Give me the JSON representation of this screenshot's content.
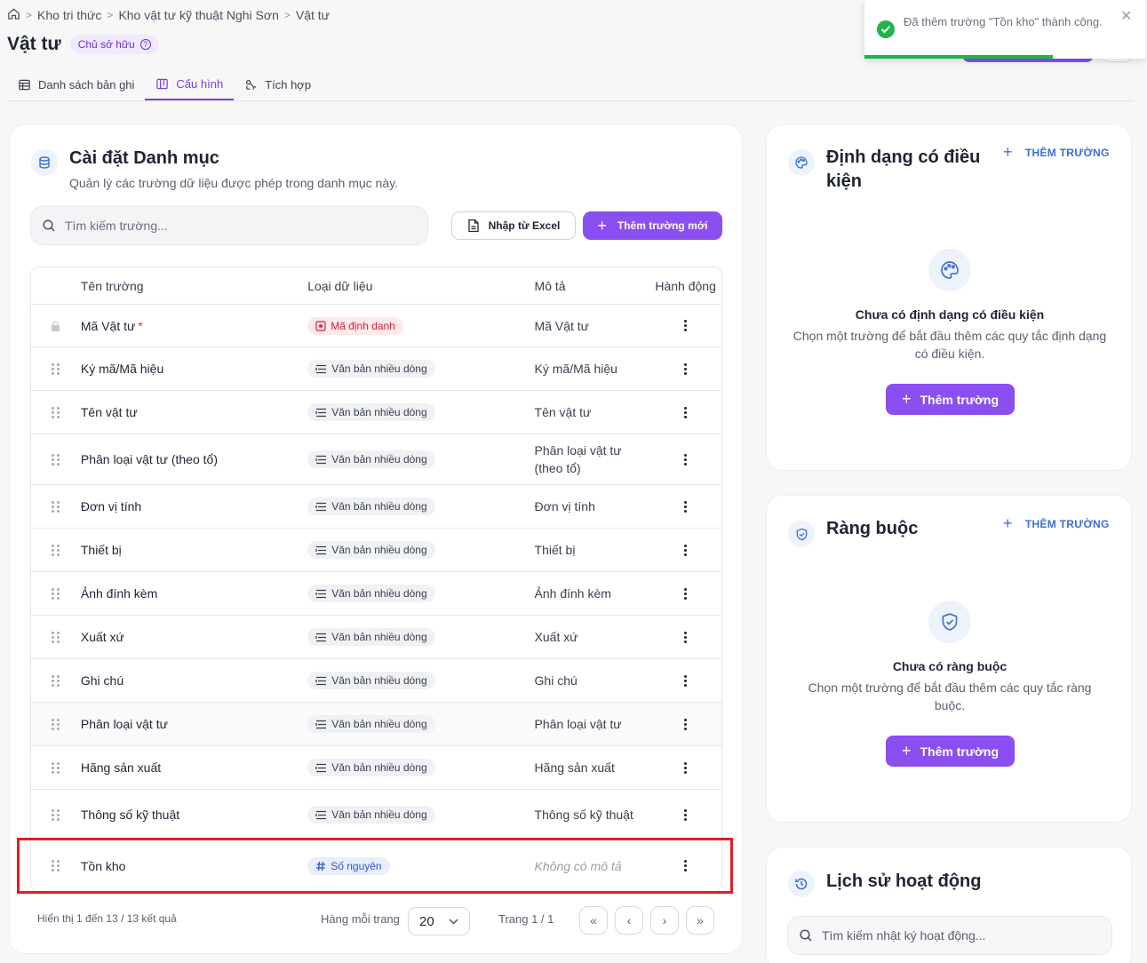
{
  "breadcrumb": {
    "items": [
      "Kho tri thức",
      "Kho vật tư kỹ thuật Nghi Sơn",
      "Vật tư"
    ]
  },
  "page": {
    "title": "Vật tư",
    "owner_badge": "Chủ sở hữu"
  },
  "tabs": [
    {
      "label": "Danh sách bản ghi",
      "active": false
    },
    {
      "label": "Cấu hình",
      "active": true
    },
    {
      "label": "Tích hợp",
      "active": false
    }
  ],
  "catalog": {
    "title": "Cài đặt Danh mục",
    "subtitle": "Quản lý các trường dữ liệu được phép trong danh mục này.",
    "search_placeholder": "Tìm kiếm trường...",
    "import_label": "Nhập từ Excel",
    "add_label": "Thêm trường mới",
    "columns": [
      "Tên trường",
      "Loại dữ liệu",
      "Mô tả",
      "Hành động"
    ],
    "rows": [
      {
        "name": "Mã Vật tư",
        "required": true,
        "locked": true,
        "type": "Mã định danh",
        "type_kind": "id",
        "desc": "Mã Vật tư"
      },
      {
        "name": "Ký mã/Mã hiệu",
        "type": "Văn bản nhiều dòng",
        "type_kind": "text",
        "desc": "Ký mã/Mã hiệu"
      },
      {
        "name": "Tên vật tư",
        "type": "Văn bản nhiều dòng",
        "type_kind": "text",
        "desc": "Tên vật tư"
      },
      {
        "name": "Phân loại vật tư (theo tổ)",
        "type": "Văn bản nhiều dòng",
        "type_kind": "text",
        "desc": "Phân loại vật tư (theo tổ)"
      },
      {
        "name": "Đơn vị tính",
        "type": "Văn bản nhiều dòng",
        "type_kind": "text",
        "desc": "Đơn vị tính"
      },
      {
        "name": "Thiết bị",
        "type": "Văn bản nhiều dòng",
        "type_kind": "text",
        "desc": "Thiết bị"
      },
      {
        "name": "Ảnh đính kèm",
        "type": "Văn bản nhiều dòng",
        "type_kind": "text",
        "desc": "Ảnh đính kèm"
      },
      {
        "name": "Xuất xứ",
        "type": "Văn bản nhiều dòng",
        "type_kind": "text",
        "desc": "Xuất xứ"
      },
      {
        "name": "Ghi chú",
        "type": "Văn bản nhiều dòng",
        "type_kind": "text",
        "desc": "Ghi chú"
      },
      {
        "name": "Phân loại vật tư",
        "type": "Văn bản nhiều dòng",
        "type_kind": "text",
        "desc": "Phân loại vật tư",
        "hover": true
      },
      {
        "name": "Hãng sản xuất",
        "type": "Văn bản nhiều dòng",
        "type_kind": "text",
        "desc": "Hãng sản xuất"
      },
      {
        "name": "Thông số kỹ thuật",
        "type": "Văn bản nhiều dòng",
        "type_kind": "text",
        "desc": "Thông số kỹ thuật"
      },
      {
        "name": "Tồn kho",
        "type": "Số nguyên",
        "type_kind": "number",
        "desc": "Không có mô tả",
        "desc_empty": true
      }
    ],
    "pagination": {
      "summary": "Hiển thị 1 đến 13 / 13 kết quả",
      "per_page_label": "Hàng mỗi trang",
      "per_page_value": "20",
      "page_label": "Trang 1 / 1"
    }
  },
  "conditional_format": {
    "title": "Định dạng có điều kiện",
    "add_link": "THÊM TRƯỜNG",
    "empty_title": "Chưa có định dạng có điều kiện",
    "empty_desc": "Chọn một trường để bắt đầu thêm các quy tắc định dạng có điều kiện.",
    "button": "Thêm trường"
  },
  "constraints": {
    "title": "Ràng buộc",
    "add_link": "THÊM TRƯỜNG",
    "empty_title": "Chưa có ràng buộc",
    "empty_desc": "Chọn một trường để bắt đầu thêm các quy tắc ràng buộc.",
    "button": "Thêm trường"
  },
  "history": {
    "title": "Lịch sử hoạt động",
    "search_placeholder": "Tìm kiếm nhật ký hoạt động..."
  },
  "toast": {
    "message": "Đã thêm trường \"Tồn kho\" thành công.",
    "progress": 0.67
  },
  "colors": {
    "accent": "#8b4ef0",
    "link": "#3b6fd6",
    "success": "#1eb54a",
    "highlight": "#e21c24"
  }
}
